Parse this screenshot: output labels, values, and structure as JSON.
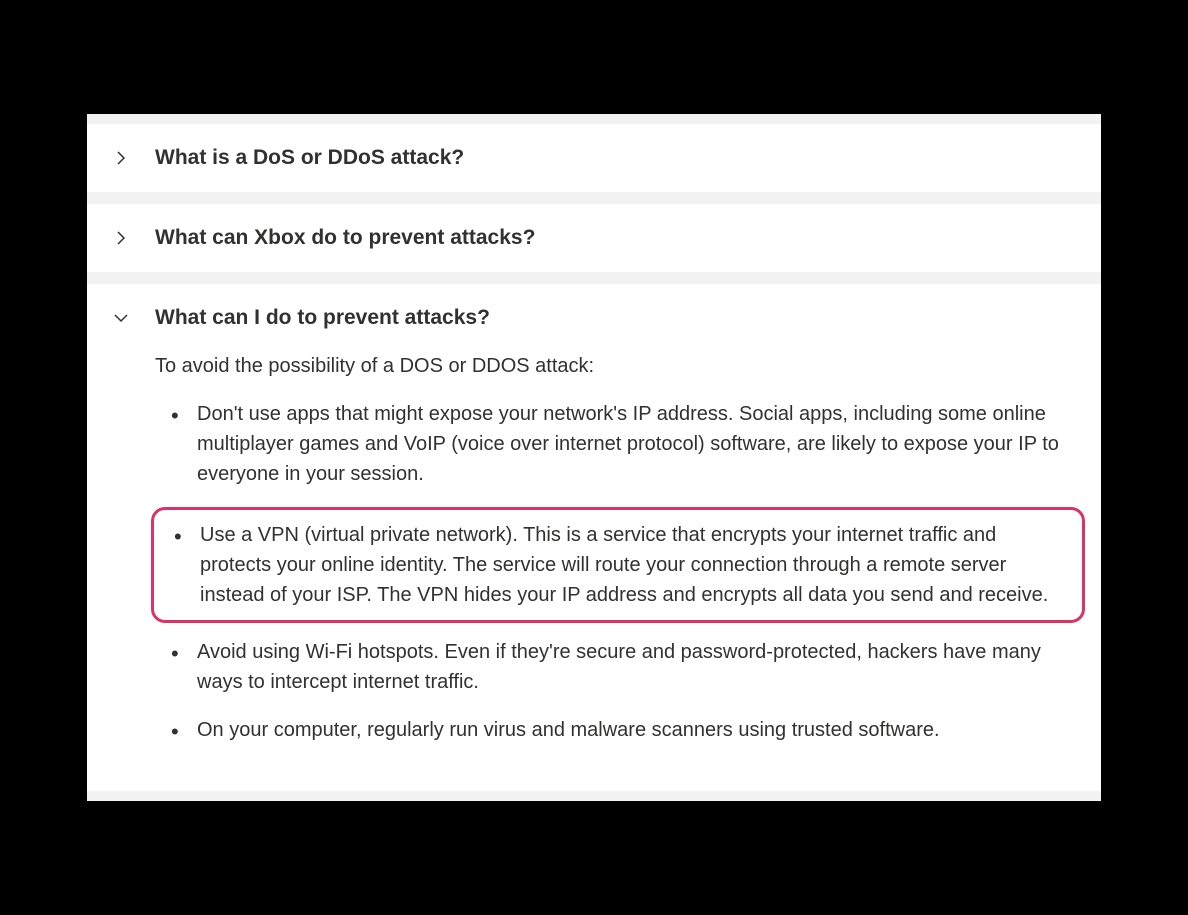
{
  "accordion": {
    "items": [
      {
        "title": "What is a DoS or DDoS attack?",
        "expanded": false
      },
      {
        "title": "What can Xbox do to prevent attacks?",
        "expanded": false
      },
      {
        "title": "What can I do to prevent attacks?",
        "expanded": true,
        "intro": "To avoid the possibility of a DOS or DDOS attack:",
        "bullets": [
          "Don't use apps that might expose your network's IP address. Social apps, including some online multiplayer games and VoIP (voice over internet protocol) software, are likely to expose your IP to everyone in your session.",
          "Use a VPN (virtual private network). This is a service that encrypts your internet traffic and protects your online identity. The service will route your connection through a remote server instead of your ISP. The VPN hides your IP address and encrypts all data you send and receive.",
          "Avoid using Wi-Fi hotspots. Even if they're secure and password-protected, hackers have many ways to intercept internet traffic.",
          "On your computer, regularly run virus and malware scanners using trusted software."
        ],
        "highlighted_index": 1
      }
    ]
  },
  "colors": {
    "highlight_border": "#d93465"
  }
}
